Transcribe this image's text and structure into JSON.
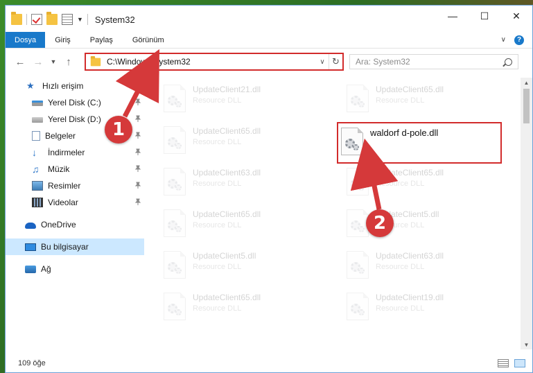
{
  "window": {
    "title": "System32"
  },
  "ribbon": {
    "tabs": [
      {
        "label": "Dosya",
        "active": true
      },
      {
        "label": "Giriş",
        "active": false
      },
      {
        "label": "Paylaş",
        "active": false
      },
      {
        "label": "Görünüm",
        "active": false
      }
    ]
  },
  "address": {
    "path": "C:\\Windows\\System32"
  },
  "search": {
    "placeholder": "Ara: System32"
  },
  "sidebar": {
    "items": [
      {
        "label": "Hızlı erişim",
        "icon": "star-icon",
        "pinned": false
      },
      {
        "label": "Yerel Disk (C:)",
        "icon": "drive-icon",
        "pinned": true
      },
      {
        "label": "Yerel Disk (D:)",
        "icon": "drive-icon",
        "pinned": true
      },
      {
        "label": "Belgeler",
        "icon": "documents-icon",
        "pinned": true
      },
      {
        "label": "İndirmeler",
        "icon": "downloads-icon",
        "pinned": true
      },
      {
        "label": "Müzik",
        "icon": "music-icon",
        "pinned": true
      },
      {
        "label": "Resimler",
        "icon": "pictures-icon",
        "pinned": true
      },
      {
        "label": "Videolar",
        "icon": "videos-icon",
        "pinned": true
      },
      {
        "label": "OneDrive",
        "icon": "onedrive-icon",
        "pinned": false
      },
      {
        "label": "Bu bilgisayar",
        "icon": "this-pc-icon",
        "pinned": false,
        "selected": true
      },
      {
        "label": "Ağ",
        "icon": "network-icon",
        "pinned": false
      }
    ]
  },
  "files": [
    {
      "name": "UpdateClient21.dll",
      "type": "Resource DLL"
    },
    {
      "name": "UpdateClient65.dll",
      "type": "Resource DLL"
    },
    {
      "name": "UpdateClient65.dll",
      "type": "Resource DLL"
    },
    {
      "name": "UpdateClient63.dll",
      "type": "Resource DLL"
    },
    {
      "name": "UpdateClient65.dll",
      "type": "Resource DLL"
    },
    {
      "name": "UpdateClient65.dll",
      "type": "Resource DLL"
    },
    {
      "name": "UpdateClient5.dll",
      "type": "Resource DLL"
    },
    {
      "name": "UpdateClient5.dll",
      "type": "Resource DLL"
    },
    {
      "name": "UpdateClient63.dll",
      "type": "Resource DLL"
    },
    {
      "name": "UpdateClient65.dll",
      "type": "Resource DLL"
    },
    {
      "name": "UpdateClient19.dll",
      "type": "Resource DLL"
    }
  ],
  "highlighted_file": {
    "name": "waldorf d-pole.dll"
  },
  "callouts": {
    "one": "1",
    "two": "2"
  },
  "status": {
    "item_count": "109 öğe"
  },
  "colors": {
    "accent": "#1979ca",
    "annotation": "#d22b2b"
  }
}
